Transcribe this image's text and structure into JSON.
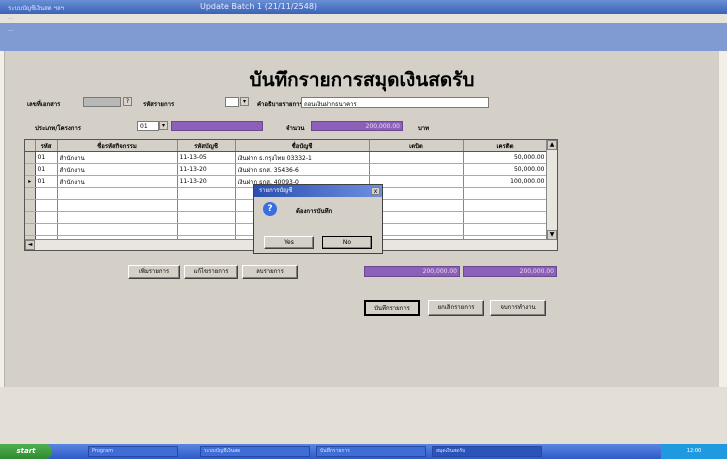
{
  "titlebar": {
    "left_text": "ระบบบัญชีเงินสด ฯลฯ",
    "center_text": "Update Batch 1 (21/11/2548)"
  },
  "address": {
    "text": "..."
  },
  "subheader": {
    "text": "..."
  },
  "form": {
    "title": "บันทึกรายการสมุดเงินสดรับ",
    "doc_label": "เลขที่เอกสาร",
    "doc_value": "",
    "type_label": "รหัสรายการ",
    "desc_label": "คำอธิบายรายการ",
    "desc_value": "ถอนเงินฝากธนาคาร",
    "category_label": "ประเภท/โครงการ",
    "category_value": "01",
    "category_name": "",
    "amount_label": "จำนวน",
    "amount_value": "200,000.00",
    "unit_label": "บาท"
  },
  "grid": {
    "columns": [
      "",
      "รหัส",
      "ชื่อรหัสกิจกรรม",
      "รหัสบัญชี",
      "ชื่อบัญชี",
      "เดบิต",
      "เครดิต"
    ],
    "rows": [
      {
        "marker": "",
        "code": "01",
        "activity": "สำนักงาน",
        "account": "11-13-05",
        "account_name": "เงินฝาก ธ.กรุงไทย 03332-1",
        "debit": "",
        "credit": "50,000.00"
      },
      {
        "marker": "",
        "code": "01",
        "activity": "สำนักงาน",
        "account": "11-13-20",
        "account_name": "เงินฝาก ธกส. 35436-6",
        "debit": "",
        "credit": "50,000.00"
      },
      {
        "marker": "▸",
        "code": "01",
        "activity": "สำนักงาน",
        "account": "11-13-20",
        "account_name": "เงินฝาก ธกส. 40093-0",
        "debit": "",
        "credit": "100,000.00"
      }
    ]
  },
  "buttons": {
    "add_row": "เพิ่มรายการ",
    "edit_row": "แก้ไขรายการ",
    "delete_row": "ลบรายการ",
    "save": "บันทึกรายการ",
    "cancel": "ยกเลิกรายการ",
    "close": "จบการทำงาน"
  },
  "totals": {
    "debit_total": "200,000.00",
    "credit_total": "200,000.00"
  },
  "dialog": {
    "title": "รายการบัญชี",
    "message": "ต้องการบันทึก",
    "yes": "Yes",
    "no": "No",
    "close": "x"
  },
  "taskbar": {
    "start": "start",
    "items": [
      "Program",
      "ระบบบัญชีเงินสด",
      "บันทึกรายการ",
      "สมุดเงินสดรับ"
    ],
    "clock": "12:00"
  },
  "colors": {
    "purple_field": "#8c60b8",
    "dialog_title": "#2a4fb0",
    "taskbar": "#2f5ac8"
  }
}
